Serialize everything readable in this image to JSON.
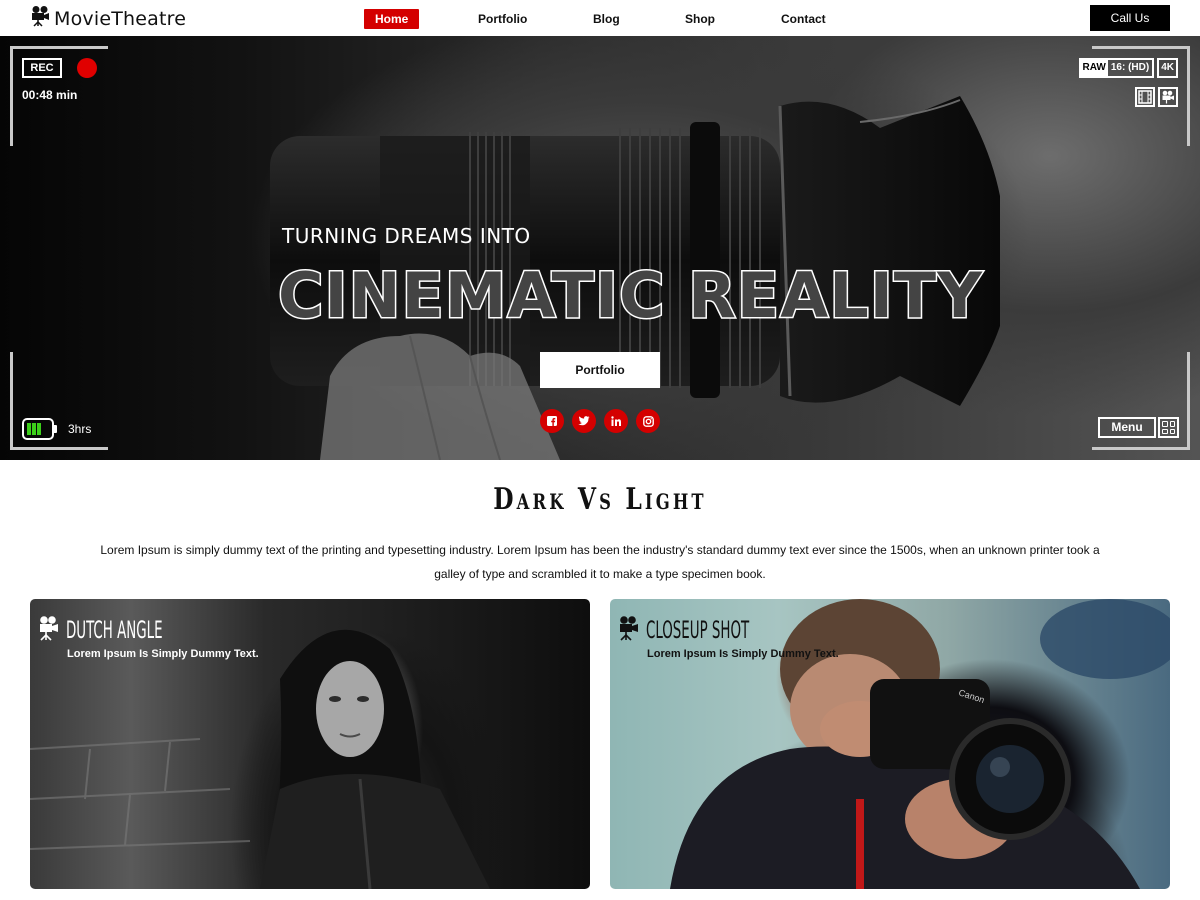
{
  "brand": {
    "name": "MovieTheatre",
    "icon": "film-camera-icon"
  },
  "nav": {
    "items": [
      {
        "label": "Home",
        "active": true
      },
      {
        "label": "Portfolio",
        "active": false
      },
      {
        "label": "Blog",
        "active": false
      },
      {
        "label": "Shop",
        "active": false
      },
      {
        "label": "Contact",
        "active": false
      }
    ],
    "cta_label": "Call Us"
  },
  "hero": {
    "rec_label": "REC",
    "rec_time": "00:48 min",
    "format_raw": "RAW",
    "format_ratio": "16: (HD)",
    "format_res": "4K",
    "battery_text": "3hrs",
    "battery_level": 0.45,
    "subtitle": "TURNING DREAMS INTO",
    "title": "CINEMATIC REALITY",
    "button_label": "Portfolio",
    "menu_label": "Menu",
    "socials": [
      "facebook-icon",
      "twitter-icon",
      "linkedin-icon",
      "instagram-icon"
    ]
  },
  "section": {
    "title": "Dark Vs Light",
    "text": "Lorem Ipsum is simply dummy text of the printing and typesetting industry. Lorem Ipsum has been the industry's standard dummy text ever since the 1500s, when an unknown printer took a galley of type and scrambled it to make a type specimen book."
  },
  "cards": [
    {
      "title": "DUTCH ANGLE",
      "desc": "Lorem Ipsum Is Simply Dummy Text."
    },
    {
      "title": "CLOSEUP SHOT",
      "desc": "Lorem Ipsum Is Simply Dummy Text."
    }
  ],
  "colors": {
    "accent": "#d40000",
    "rec": "#e00000",
    "battery": "#3ccf1a"
  }
}
